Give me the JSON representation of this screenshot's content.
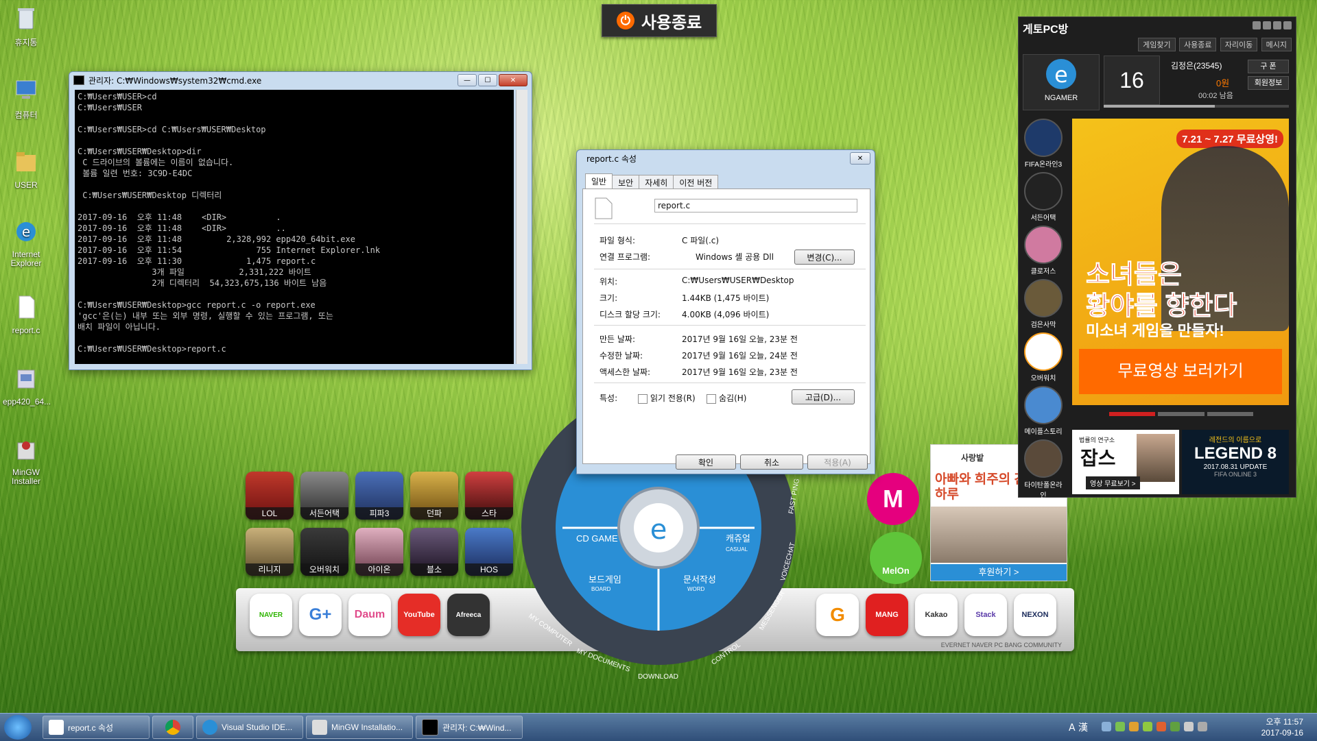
{
  "desktop_icons": [
    {
      "label": "휴지통"
    },
    {
      "label": "컴퓨터"
    },
    {
      "label": "USER"
    },
    {
      "label": "Internet\nExplorer"
    },
    {
      "label": "report.c"
    },
    {
      "label": "epp420_64..."
    },
    {
      "label": "MinGW\nInstaller"
    }
  ],
  "shutdown_button": {
    "label": "사용종료"
  },
  "cmd_window": {
    "title": "관리자: C:₩Windows₩system32₩cmd.exe",
    "output": "C:₩Users₩USER>cd\nC:₩Users₩USER\n\nC:₩Users₩USER>cd C:₩Users₩USER₩Desktop\n\nC:₩Users₩USER₩Desktop>dir\n C 드라이브의 볼륨에는 이름이 없습니다.\n 볼륨 일련 번호: 3C9D-E4DC\n\n C:₩Users₩USER₩Desktop 디렉터리\n\n2017-09-16  오후 11:48    <DIR>          .\n2017-09-16  오후 11:48    <DIR>          ..\n2017-09-16  오후 11:48         2,328,992 epp420_64bit.exe\n2017-09-16  오후 11:54               755 Internet Explorer.lnk\n2017-09-16  오후 11:30             1,475 report.c\n               3개 파일           2,331,222 바이트\n               2개 디렉터리  54,323,675,136 바이트 남음\n\nC:₩Users₩USER₩Desktop>gcc report.c -o report.exe\n'gcc'은(는) 내부 또는 외부 명령, 실행할 수 있는 프로그램, 또는\n배치 파일이 아닙니다.\n\nC:₩Users₩USER₩Desktop>report.c"
  },
  "properties_dialog": {
    "title": "report.c 속성",
    "tabs": [
      "일반",
      "보안",
      "자세히",
      "이전 버전"
    ],
    "file_name": "report.c",
    "rows": {
      "type_label": "파일 형식:",
      "type_value": "C 파일(.c)",
      "open_label": "연결 프로그램:",
      "open_value": "Windows 셸 공용 Dll",
      "change_button": "변경(C)...",
      "location_label": "위치:",
      "location_value": "C:₩Users₩USER₩Desktop",
      "size_label": "크기:",
      "size_value": "1.44KB (1,475 바이트)",
      "disk_label": "디스크 할당 크기:",
      "disk_value": "4.00KB (4,096 바이트)",
      "created_label": "만든 날짜:",
      "created_value": "2017년 9월 16일 오늘, 23분 전",
      "modified_label": "수정한 날짜:",
      "modified_value": "2017년 9월 16일 오늘, 24분 전",
      "accessed_label": "액세스한 날짜:",
      "accessed_value": "2017년 9월 16일 오늘, 23분 전",
      "attr_label": "특성:",
      "readonly_label": "읽기 전용(R)",
      "hidden_label": "숨김(H)",
      "advanced_button": "고급(D)..."
    },
    "buttons": {
      "ok": "확인",
      "cancel": "취소",
      "apply": "적용(A)"
    }
  },
  "launcher": {
    "game_tiles": [
      "LOL",
      "서든어택",
      "피파3",
      "던파",
      "스타",
      "리니지",
      "오버워치",
      "아이온",
      "블소",
      "HOS"
    ],
    "wheel": {
      "cd_game": "CD GAME",
      "casual": "캐쥬얼",
      "casual_en": "CASUAL",
      "board": "보드게임",
      "board_en": "BOARD",
      "word": "문서작성",
      "word_en": "WORD",
      "my_computer": "MY COMPUTER",
      "my_documents": "MY DOCUMENTS",
      "download": "DOWNLOAD",
      "control": "CONTROL",
      "messenger": "MESSENGER",
      "voicechat": "VOICECHAT",
      "fast_ping": "FAST PING"
    },
    "shelf_left_apps": [
      "NAVER",
      "G+",
      "Daum",
      "YouTube",
      "Afreeca"
    ],
    "shelf_right_apps": [
      "G",
      "MANG",
      "Kakao",
      "Stack",
      "NEXON"
    ],
    "shelf_caption": "EVERNET NAVER PC BANG COMMUNITY",
    "melon_label": "MelOn",
    "donation": {
      "org": "사랑밭",
      "headline": "아빠와 희주의 간절한 하루",
      "button": "후원하기 >"
    }
  },
  "side_panel": {
    "title": "게토PC방",
    "top_buttons": [
      "게임찾기",
      "사용종료",
      "자리이동",
      "메시지"
    ],
    "brand": "NGAMER",
    "seat_number": "16",
    "user": "김정은(23545)",
    "balance": "0원",
    "remaining": "00:02 남음",
    "buy_label": "구 폰",
    "member_info": "회원정보",
    "side_games": [
      "FIFA온라인3",
      "서든어택",
      "클로저스",
      "검은사막",
      "오버워치",
      "메이플스토리",
      "타이탄폴온라인"
    ],
    "ad": {
      "date_badge": "7.21 ~ 7.27 무료상영!",
      "headline1": "소녀들은",
      "headline2": "황야를 향한다",
      "sub": "미소녀 게임을 만들자!",
      "cta": "무료영상 보러가기"
    },
    "banner_left": {
      "small": "법률의 연구소",
      "title": "잡스",
      "cta": "영상 무료보기 >"
    },
    "banner_right": {
      "small": "레전드의 이름으로",
      "title": "LEGEND 8",
      "date": "2017.08.31 UPDATE",
      "brand": "FIFA ONLINE 3"
    }
  },
  "taskbar": {
    "items": [
      "report.c 속성",
      "",
      "Visual Studio IDE...",
      "MinGW Installatio...",
      "관리자: C:₩Wind..."
    ],
    "tray_lang": "A 漢",
    "time": "오후 11:57",
    "date": "2017-09-16"
  },
  "colors": {
    "accent_blue": "#2a8fd6",
    "orange": "#ff7a00",
    "panel_bg": "#1e1e1e"
  }
}
